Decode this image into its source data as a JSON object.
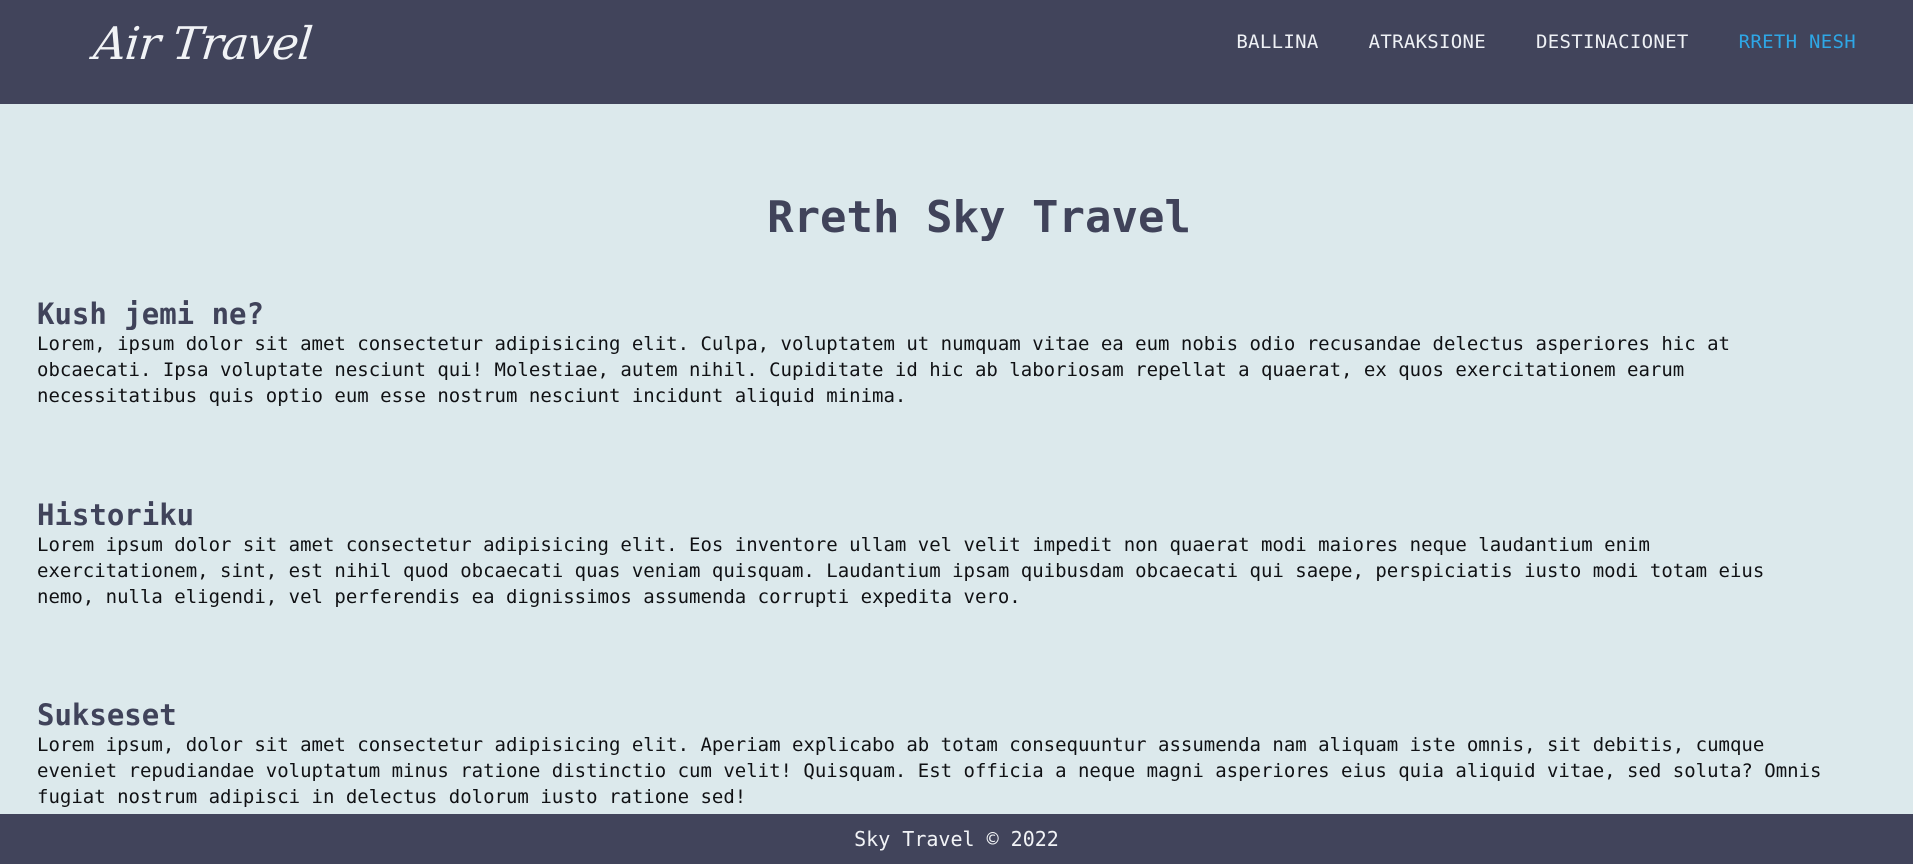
{
  "header": {
    "logo_text": "Air Travel",
    "nav": [
      {
        "label": "BALLINA"
      },
      {
        "label": "ATRAKSIONE"
      },
      {
        "label": "DESTINACIONET"
      },
      {
        "label": "RRETH NESH",
        "active": true
      }
    ]
  },
  "main": {
    "title": "Rreth Sky Travel",
    "sections": [
      {
        "heading": "Kush jemi ne?",
        "lines": [
          "Lorem, ipsum dolor sit amet consectetur adipisicing elit. Culpa, voluptatem ut numquam vitae ea eum nobis odio recusandae delectus asperiores hic at",
          "obcaecati. Ipsa voluptate nesciunt qui! Molestiae, autem nihil. Cupiditate id hic ab laboriosam repellat a quaerat, ex quos exercitationem earum",
          "necessitatibus quis optio eum esse nostrum nesciunt incidunt aliquid minima."
        ]
      },
      {
        "heading": "Historiku",
        "lines": [
          "Lorem ipsum dolor sit amet consectetur adipisicing elit. Eos inventore ullam vel velit impedit non quaerat modi maiores neque laudantium enim",
          "exercitationem, sint, est nihil quod obcaecati quas veniam quisquam. Laudantium ipsam quibusdam obcaecati qui saepe, perspiciatis iusto modi totam eius",
          "nemo, nulla eligendi, vel perferendis ea dignissimos assumenda corrupti expedita vero."
        ]
      },
      {
        "heading": "Sukseset",
        "lines": [
          "Lorem ipsum, dolor sit amet consectetur adipisicing elit. Aperiam explicabo ab totam consequuntur assumenda nam aliquam iste omnis, sit debitis, cumque",
          "eveniet repudiandae voluptatum minus ratione distinctio cum velit! Quisquam. Est officia a neque magni asperiores eius quia aliquid vitae, sed soluta? Omnis",
          "fugiat nostrum adipisci in delectus dolorum iusto ratione sed!"
        ]
      }
    ]
  },
  "footer": {
    "text": "Sky Travel © 2022"
  }
}
